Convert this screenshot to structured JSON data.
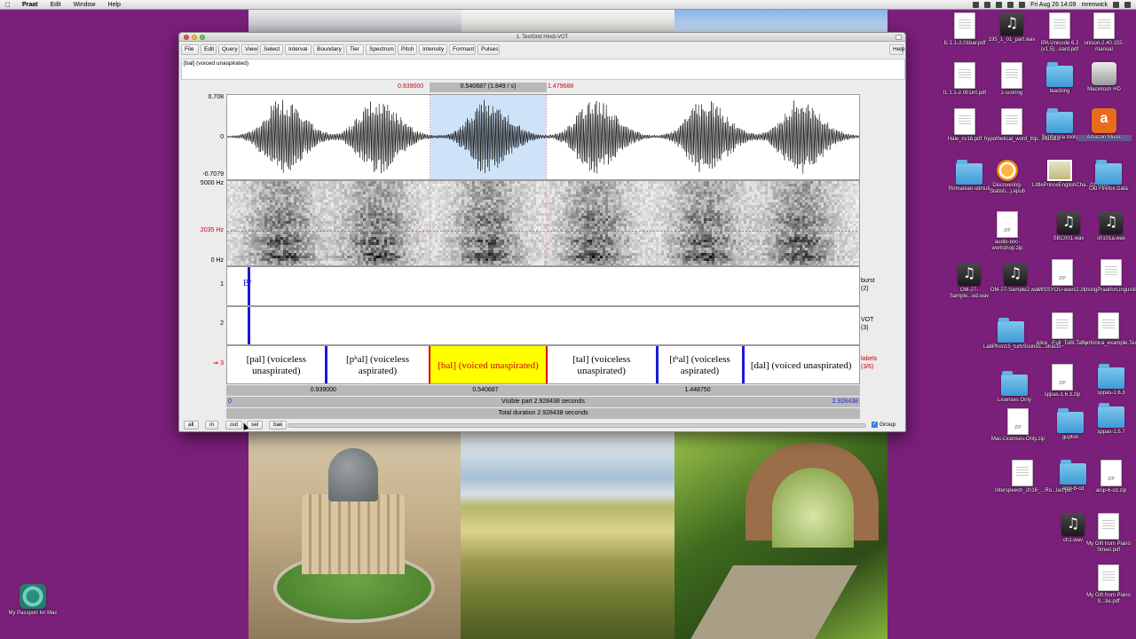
{
  "menubar": {
    "apple": "",
    "items": [
      "Praat",
      "Edit",
      "Window",
      "Help"
    ],
    "clock": "Fri Aug 26  14:09",
    "user": "mrenwick"
  },
  "window": {
    "title": "1. TextGrid Hindi-VOT",
    "menus": [
      "File",
      "Edit",
      "Query",
      "View",
      "Select",
      "Interval",
      "Boundary",
      "Tier",
      "Spectrum",
      "Pitch",
      "Intensity",
      "Formant",
      "Pulses"
    ],
    "help": "Help",
    "text_field_value": "[bal] (voiced unaspirated)",
    "selection": {
      "start": "0.939000",
      "duration": "0.540687 (1.849 / s)",
      "end": "1.479688",
      "start_frac": 0.3207,
      "end_frac": 0.5053
    },
    "waveform": {
      "max": "0.708",
      "zero": "0",
      "min": "-0.7079"
    },
    "spectrogram": {
      "max": "5000 Hz",
      "cursor": "2035 Hz",
      "min": "0 Hz",
      "cursor_frac": 0.407
    },
    "tiers": [
      {
        "number": "1",
        "name": "burst",
        "count": "(2)",
        "marker_text": "B/"
      },
      {
        "number": "2",
        "name": "VOT",
        "count": "(3)"
      },
      {
        "number": "3",
        "name": "labels",
        "count": "(3/6)",
        "active_marker": "⇒"
      }
    ],
    "segments": [
      {
        "text": "[pal] (voiceless unaspirated)",
        "start_frac": 0.0,
        "end_frac": 0.1555
      },
      {
        "text": "[pʰal] (voiceless aspirated)",
        "start_frac": 0.1555,
        "end_frac": 0.3207
      },
      {
        "text": "[bal] (voiced unaspirated)",
        "start_frac": 0.3207,
        "end_frac": 0.5053,
        "selected": true
      },
      {
        "text": "[tal] (voiceless unaspirated)",
        "start_frac": 0.5053,
        "end_frac": 0.6793
      },
      {
        "text": "[tʰal] (voiceless aspirated)",
        "start_frac": 0.6793,
        "end_frac": 0.8165
      },
      {
        "text": "[dal] (voiced unaspirated)",
        "start_frac": 0.8165,
        "end_frac": 1.0
      }
    ],
    "boundary_times": [
      {
        "label": "0.939000",
        "frac": 0.1555
      },
      {
        "label": "0.540687",
        "frac": 0.412
      },
      {
        "label": "1.448750",
        "frac": 0.7479
      }
    ],
    "visible": {
      "left": "0",
      "middle": "Visible part 2.928438 seconds",
      "right": "2.928438"
    },
    "total": "Total duration 2.928438 seconds",
    "buttons": {
      "all": "all",
      "in": "in",
      "out": "out",
      "sel": "sel",
      "bak": "bak"
    },
    "group_label": "Group",
    "group_checked": "✓",
    "colors": {
      "boundary": "#1a1ad4",
      "selection": "#d4000d",
      "highlight": "#ffff00",
      "select_bg": "#cfe3f8"
    }
  },
  "desktop_icons": [
    {
      "label": "IL 1.1-2.01bar.pdf",
      "type": "doc"
    },
    {
      "label": "195_1_01_part.wav",
      "type": "audio"
    },
    {
      "label": "IPA Unicode 6.2 (v1.5)...oard.pdf",
      "type": "doc"
    },
    {
      "label": "unison-2.40.102-manual",
      "type": "doc"
    },
    {
      "label": "IL 1.1-2.001int.pdf",
      "type": "doc"
    },
    {
      "label": "z-scoring",
      "type": "doc"
    },
    {
      "label": "teaching",
      "type": "folder"
    },
    {
      "label": "Macintosh HD",
      "type": "hd"
    },
    {
      "label": "Hale_cv16.pdf",
      "type": "doc"
    },
    {
      "label": "hypothetical_word_trip...etadata",
      "type": "doc"
    },
    {
      "label": "Synfonica tools",
      "type": "folder"
    },
    {
      "label": "Amazon Music",
      "type": "amazon"
    },
    {
      "label": "Romanian-stimuli",
      "type": "folder"
    },
    {
      "label": "Discovering-Statisti...).epub",
      "type": "epub"
    },
    {
      "label": "LittlePrinceEnglishCha...01.mp3",
      "type": "image"
    },
    {
      "label": "Old Firefox Data",
      "type": "folder"
    },
    {
      "label": "audio-bnc-workshop.zip",
      "type": "zip"
    },
    {
      "label": "SBC001.wav",
      "type": "audio"
    },
    {
      "label": "s0101a.wav",
      "type": "audio"
    },
    {
      "label": "OM-27-Sample...ed.wav",
      "type": "audio"
    },
    {
      "label": "OM-27-Sample2.wav",
      "type": "audio"
    },
    {
      "label": "MISSYOU-wavs2.zip",
      "type": "zip"
    },
    {
      "label": "UsingPraatforLinguisti...est.pdf",
      "type": "doc"
    },
    {
      "label": "LabPhon15_turbSounds...stracts",
      "type": "folder"
    },
    {
      "label": "Alice_-Full_ToBI.Table",
      "type": "doc"
    },
    {
      "label": "Synfonica_example.TextGrid",
      "type": "doc"
    },
    {
      "label": "sppas-1.6.3.zip",
      "type": "zip"
    },
    {
      "label": "sppas-1.6.3",
      "type": "folder"
    },
    {
      "label": "Licenses Only",
      "type": "folder"
    },
    {
      "label": "gupton",
      "type": "folder"
    },
    {
      "label": "sppas-1.5.7",
      "type": "folder"
    },
    {
      "label": "Mac-Licenses-Only.zip",
      "type": "zip"
    },
    {
      "label": "Interspeech_2016_...Ro...lan.pdf",
      "type": "doc"
    },
    {
      "label": "acip-6-cd",
      "type": "folder"
    },
    {
      "label": "acip-6-cd.zip",
      "type": "zip"
    },
    {
      "label": "ch1.wav",
      "type": "audio"
    },
    {
      "label": "My Gift from Piano Street.pdf",
      "type": "doc"
    },
    {
      "label": "My Gift from Piano S...tie.pdf",
      "type": "doc"
    },
    {
      "label": "My Passport for Mac",
      "type": "tm"
    }
  ]
}
